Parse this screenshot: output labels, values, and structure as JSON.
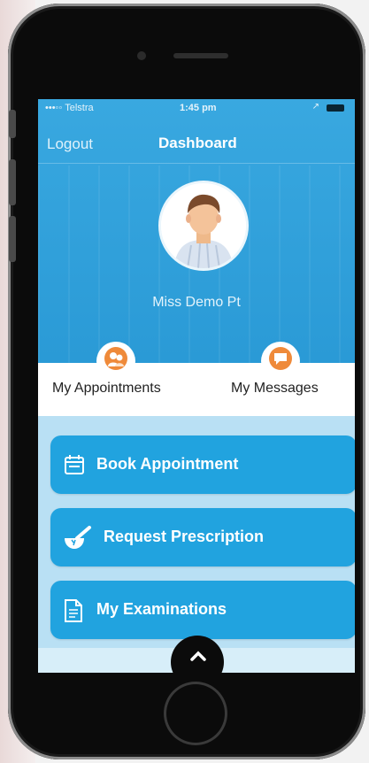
{
  "status_bar": {
    "carrier": "•••◦◦ Telstra",
    "time": "1:45 pm",
    "location_arrow": "↗"
  },
  "navbar": {
    "logout_label": "Logout",
    "title": "Dashboard"
  },
  "profile": {
    "name": "Miss Demo Pt",
    "avatar_icon": "user-avatar"
  },
  "tabs": [
    {
      "label": "My Appointments",
      "icon": "appointment-people-icon"
    },
    {
      "label": "My Messages",
      "icon": "chat-bubble-icon"
    }
  ],
  "actions": [
    {
      "label": "Book Appointment",
      "icon": "calendar-icon"
    },
    {
      "label": "Request Prescription",
      "icon": "mortar-pestle-icon"
    },
    {
      "label": "My Examinations",
      "icon": "document-icon"
    }
  ],
  "colors": {
    "header_blue": "#2a9ad6",
    "button_blue": "#21a3df",
    "tab_icon_orange": "#ef8a3a"
  }
}
